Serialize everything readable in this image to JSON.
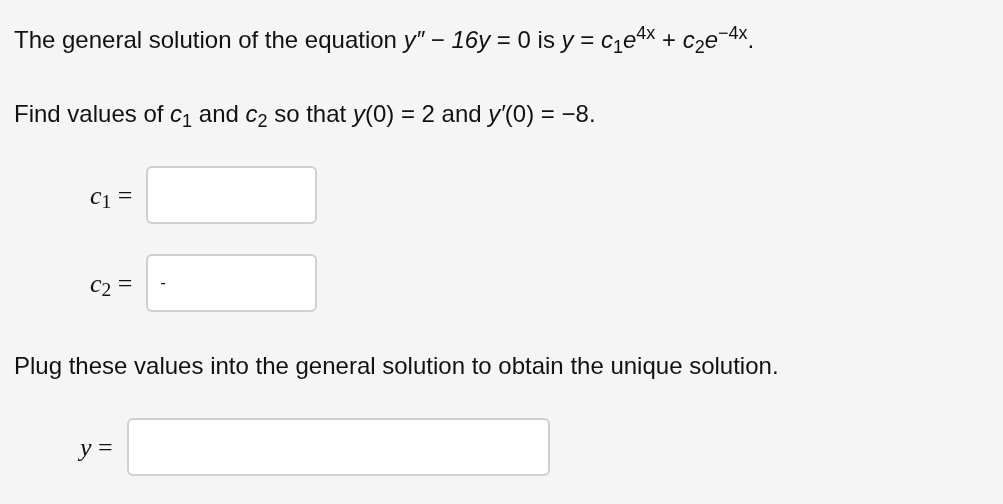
{
  "statement": "The general solution of the equation *y″* − *16y* = 0 is *y* = *c*$_{1}$*e*$^{4x}$ + *c*$_{2}$*e*$^{−4x}$.",
  "task": "Find values of *c*$_{1}$ and *c*$_{2}$ so that *y*(0) = 2 and *y′*(0) = −8.",
  "answers": [
    {
      "kind": "short",
      "label": "*c*$_{1}$ ="
    },
    {
      "kind": "short",
      "label": "*c*$_{2}$ =",
      "value": "-"
    }
  ],
  "instruction": "Plug these values into the general solution to obtain the unique solution.",
  "solution": {
    "kind": "long",
    "label": "*y* ="
  }
}
